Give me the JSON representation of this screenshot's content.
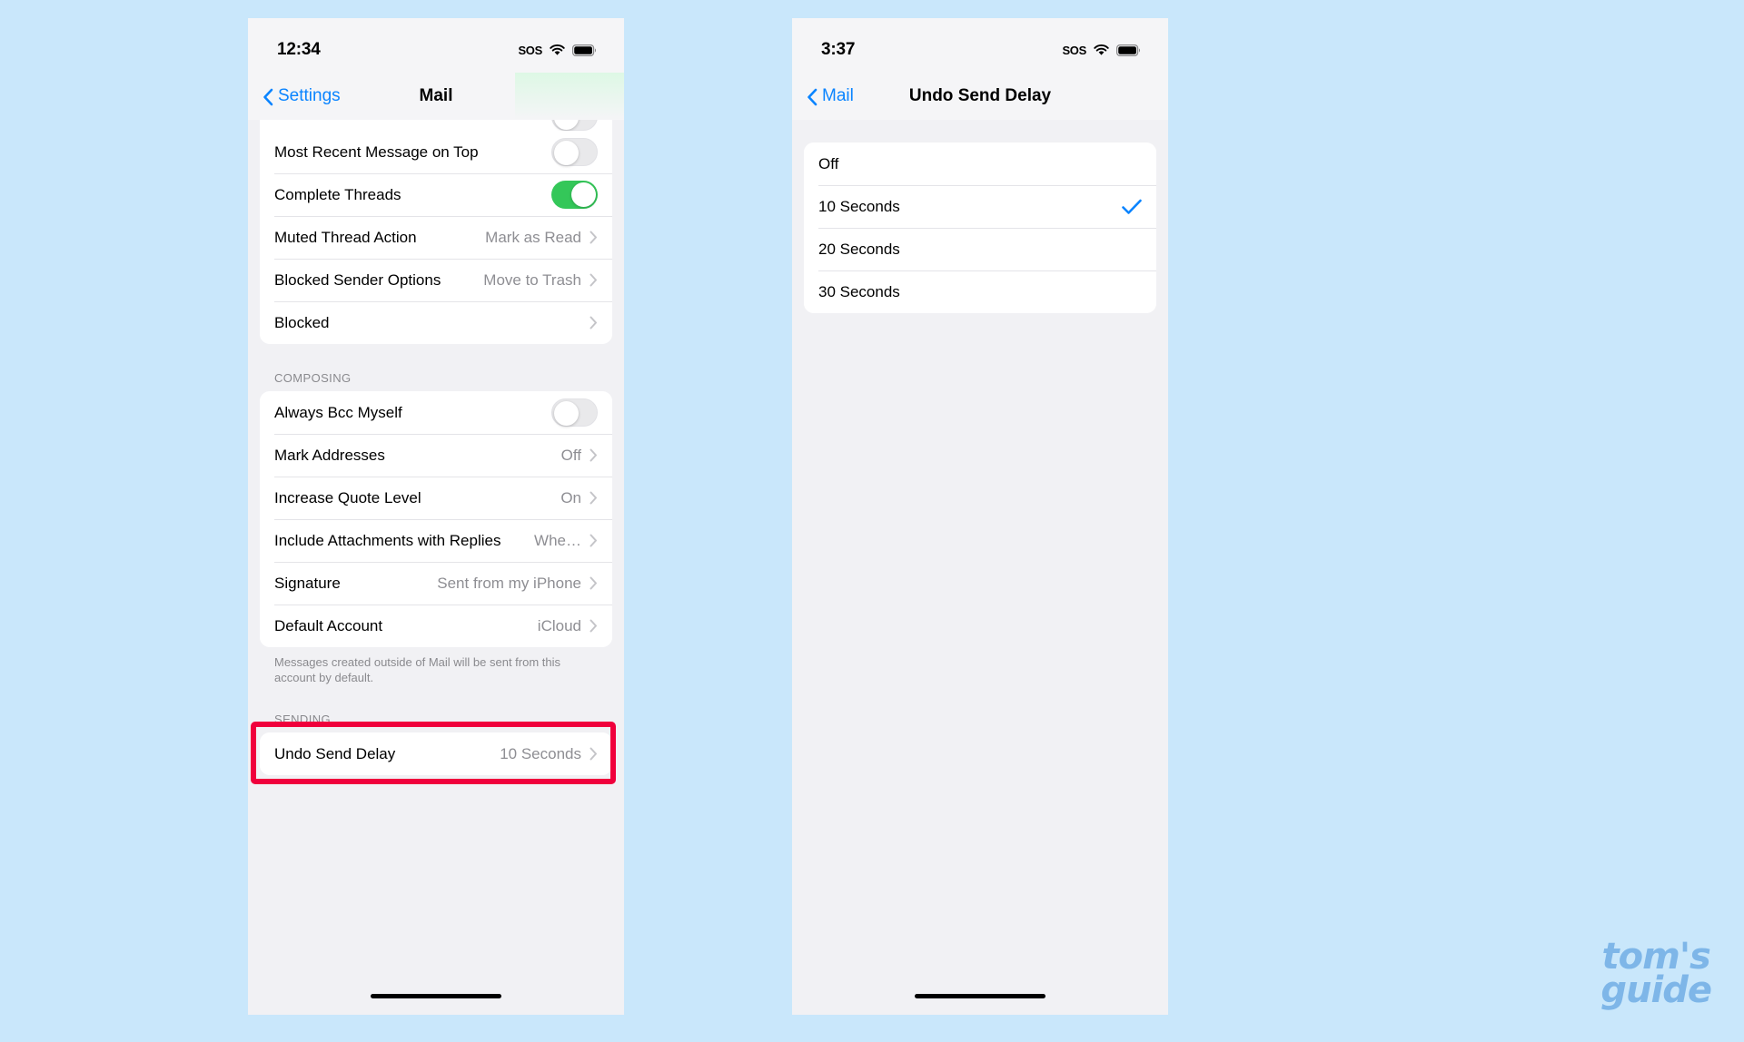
{
  "background_color": "#c9e7fb",
  "accent_blue": "#0a84ff",
  "toggle_on_green": "#34c759",
  "highlight_red": "#f0003c",
  "watermark": {
    "line1": "tom's",
    "line2": "guide",
    "color": "#7eb6e8"
  },
  "left_phone": {
    "status": {
      "time": "12:34",
      "sos": "SOS",
      "wifi_icon": "wifi-icon",
      "battery_icon": "battery-icon"
    },
    "nav": {
      "back_label": "Settings",
      "back_icon": "chevron-left-icon",
      "title": "Mail"
    },
    "groups": [
      {
        "name": "threading-group",
        "rows": [
          {
            "label": "Most Recent Message on Top",
            "control": "toggle",
            "toggle_state": "off"
          },
          {
            "label": "Complete Threads",
            "control": "toggle",
            "toggle_state": "on"
          },
          {
            "label": "Muted Thread Action",
            "value": "Mark as Read",
            "control": "chevron",
            "chevron_icon": "chevron-right-icon"
          },
          {
            "label": "Blocked Sender Options",
            "value": "Move to Trash",
            "control": "chevron",
            "chevron_icon": "chevron-right-icon"
          },
          {
            "label": "Blocked",
            "value": "",
            "control": "chevron",
            "chevron_icon": "chevron-right-icon"
          }
        ]
      }
    ],
    "composing": {
      "header": "COMPOSING",
      "rows": [
        {
          "label": "Always Bcc Myself",
          "control": "toggle",
          "toggle_state": "off"
        },
        {
          "label": "Mark Addresses",
          "value": "Off",
          "control": "chevron",
          "chevron_icon": "chevron-right-icon"
        },
        {
          "label": "Increase Quote Level",
          "value": "On",
          "control": "chevron",
          "chevron_icon": "chevron-right-icon"
        },
        {
          "label": "Include Attachments with Replies",
          "value": "Whe…",
          "control": "chevron",
          "chevron_icon": "chevron-right-icon"
        },
        {
          "label": "Signature",
          "value": "Sent from my iPhone",
          "control": "chevron",
          "chevron_icon": "chevron-right-icon"
        },
        {
          "label": "Default Account",
          "value": "iCloud",
          "control": "chevron",
          "chevron_icon": "chevron-right-icon"
        }
      ],
      "footer": "Messages created outside of Mail will be sent from this account by default."
    },
    "sending": {
      "header": "SENDING",
      "rows": [
        {
          "label": "Undo Send Delay",
          "value": "10 Seconds",
          "control": "chevron",
          "chevron_icon": "chevron-right-icon",
          "highlighted": true
        }
      ]
    }
  },
  "right_phone": {
    "status": {
      "time": "3:37",
      "sos": "SOS",
      "wifi_icon": "wifi-icon",
      "battery_icon": "battery-icon"
    },
    "nav": {
      "back_label": "Mail",
      "back_icon": "chevron-left-icon",
      "title": "Undo Send Delay"
    },
    "options": [
      {
        "label": "Off",
        "selected": false
      },
      {
        "label": "10 Seconds",
        "selected": true,
        "check_icon": "checkmark-icon"
      },
      {
        "label": "20 Seconds",
        "selected": false
      },
      {
        "label": "30 Seconds",
        "selected": false
      }
    ]
  }
}
